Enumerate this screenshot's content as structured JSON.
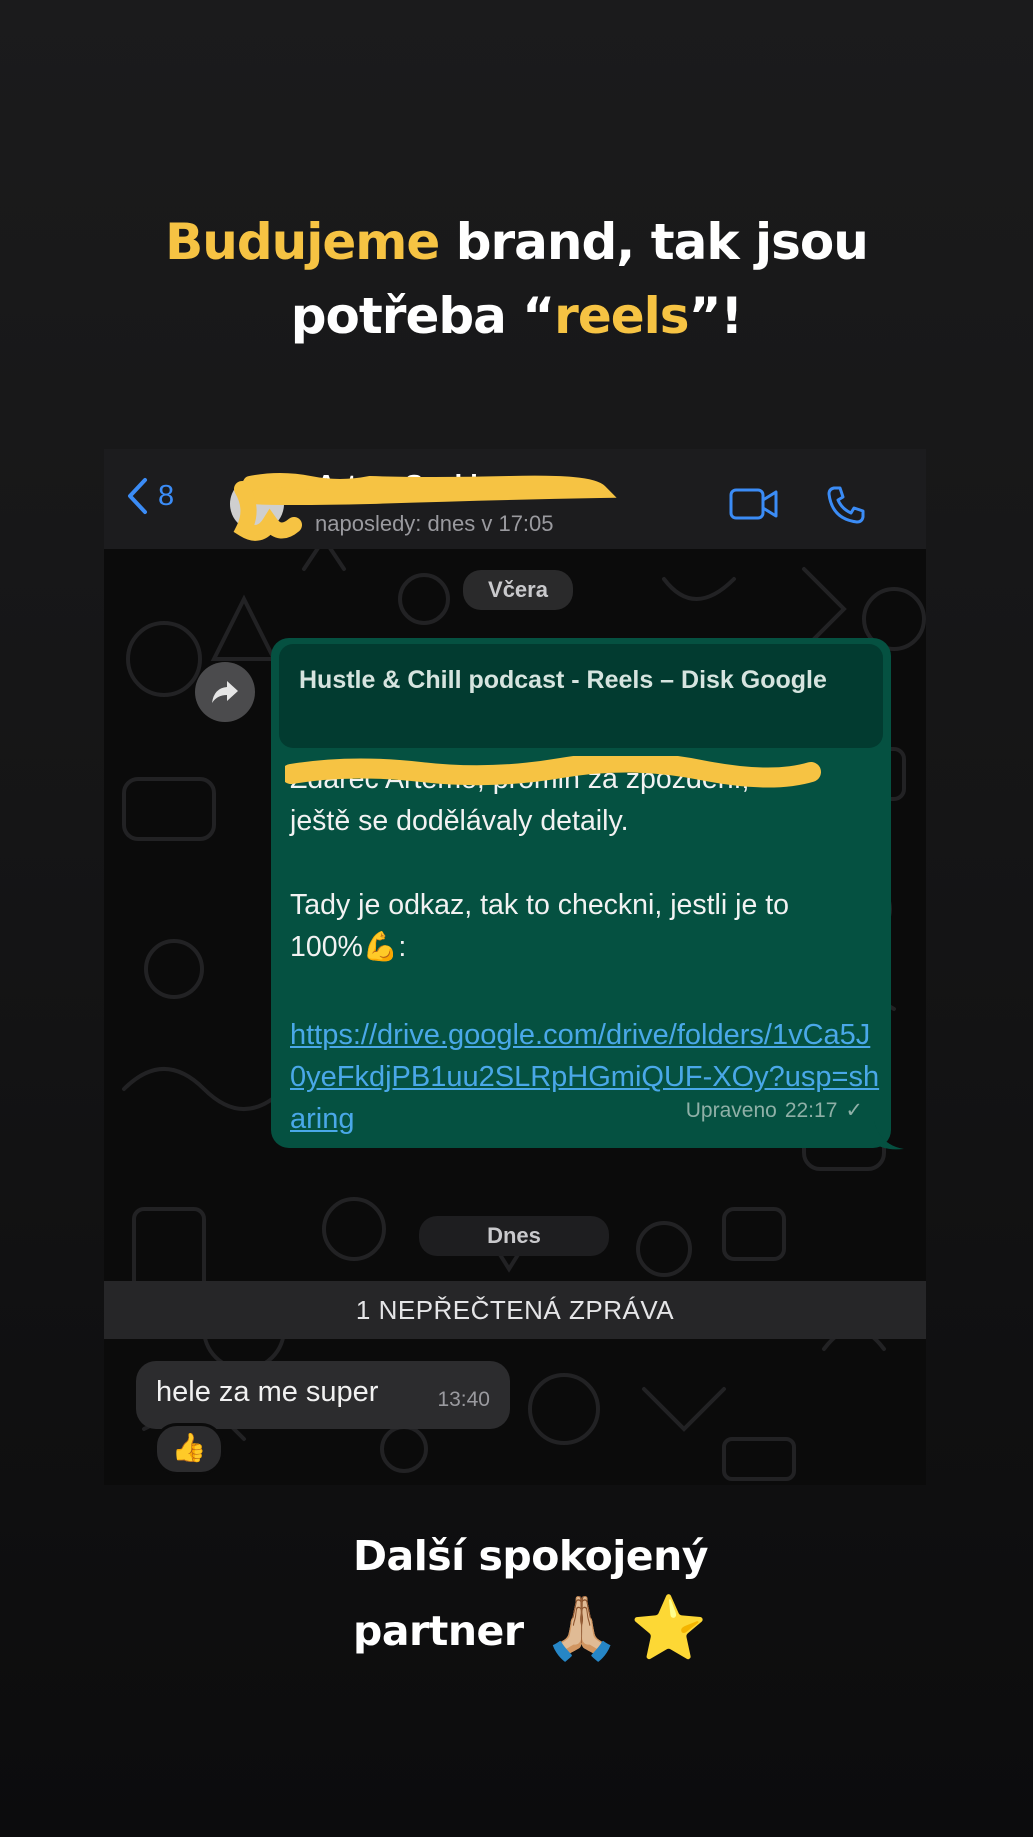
{
  "headline": {
    "accent_1": "Budujeme",
    "text_1": " brand, tak jsou",
    "text_2": "potřeba “",
    "accent_2": "reels",
    "text_3": "”!"
  },
  "header": {
    "back_count": "8",
    "contact_name": "Artem Saykin",
    "last_seen": "naposledy: dnes v 17:05",
    "icons": [
      "chevron-left-icon",
      "video-call-icon",
      "phone-icon"
    ]
  },
  "day_yesterday": "Včera",
  "outgoing": {
    "link_preview_title": "Hustle & Chill podcast - Reels – Disk Google",
    "text": "Zdarec Artéme, promiň za zpoždění,\nještě se dodělávaly detaily.\n\nTady je odkaz, tak to checkni, jestli je to\n100%💪:",
    "link": "https://drive.google.com/drive/folders/1vCa5J0yeFkdjPB1uu2SLRpHGmiQUF-XOy?usp=sharing",
    "edited_label": "Upraveno",
    "time": "22:17",
    "status": "✓"
  },
  "day_today": "Dnes",
  "unread_banner": "1 NEPŘEČTENÁ ZPRÁVA",
  "incoming": {
    "text": "hele za me super",
    "time": "13:40",
    "reaction": "👍"
  },
  "caption": {
    "line1": "Další spokojený",
    "line2": "partner",
    "emojis": [
      "🙏🏼",
      "⭐"
    ]
  },
  "colors": {
    "accent": "#f6c343",
    "bubble_out": "#055141",
    "link": "#4aa8e8",
    "ios_blue": "#3b8cf6"
  }
}
